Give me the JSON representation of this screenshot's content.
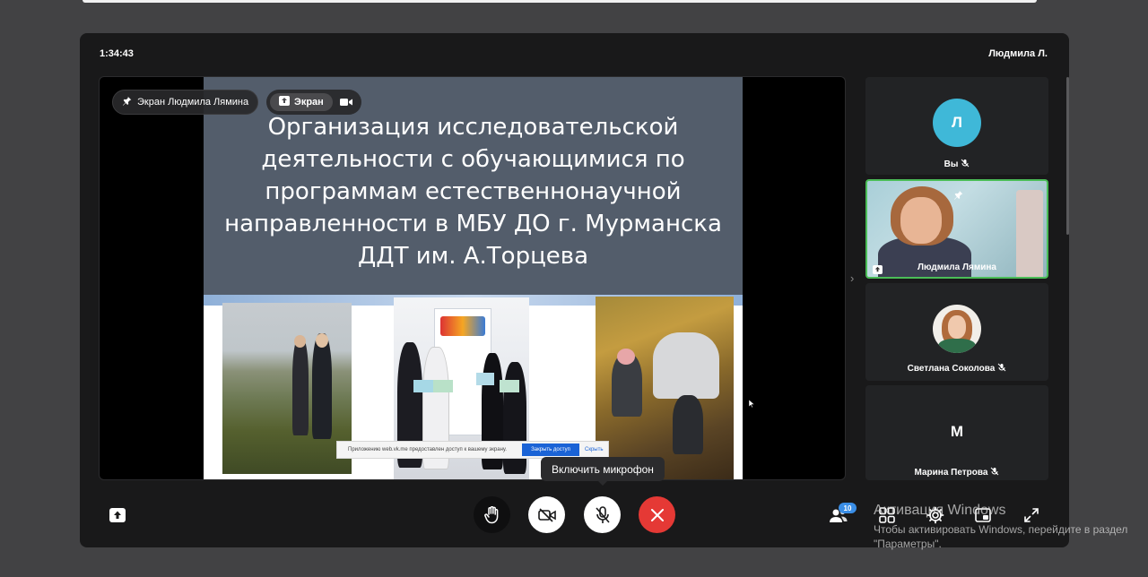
{
  "header": {
    "timer": "1:34:43",
    "user_name": "Людмила Л."
  },
  "stage": {
    "pin_label": "Экран Людмила Лямина",
    "screen_button_label": "Экран",
    "slide": {
      "title_lines": [
        "Организация исследовательской",
        "деятельности с обучающимися по",
        "программам естественнонаучной",
        "направленности в МБУ ДО г. Мурманска",
        "ДДТ им. А.Торцева"
      ],
      "notice_text": "Приложению web.vk.me предоставлен доступ к вашему экрану.",
      "notice_button": "Закрыть доступ",
      "notice_hide": "Скрыть"
    }
  },
  "participants": [
    {
      "name": "Вы",
      "initial": "Л",
      "color": "#3fb8d8",
      "muted": true
    },
    {
      "name": "Людмила Лямина",
      "video": true,
      "pinned": true,
      "sharing": true
    },
    {
      "name": "Светлана Соколова",
      "photo": true,
      "muted": true
    },
    {
      "name": "Марина Петрова",
      "initial": "М",
      "color": "#3dae3f",
      "muted": true
    }
  ],
  "controls": {
    "tooltip": "Включить микрофон",
    "participants_count": "10",
    "end_call_color": "#e53935"
  },
  "watermark": {
    "line1": "Активация Windows",
    "line2": "Чтобы активировать Windows, перейдите в раздел",
    "line3": "\"Параметры\"."
  }
}
